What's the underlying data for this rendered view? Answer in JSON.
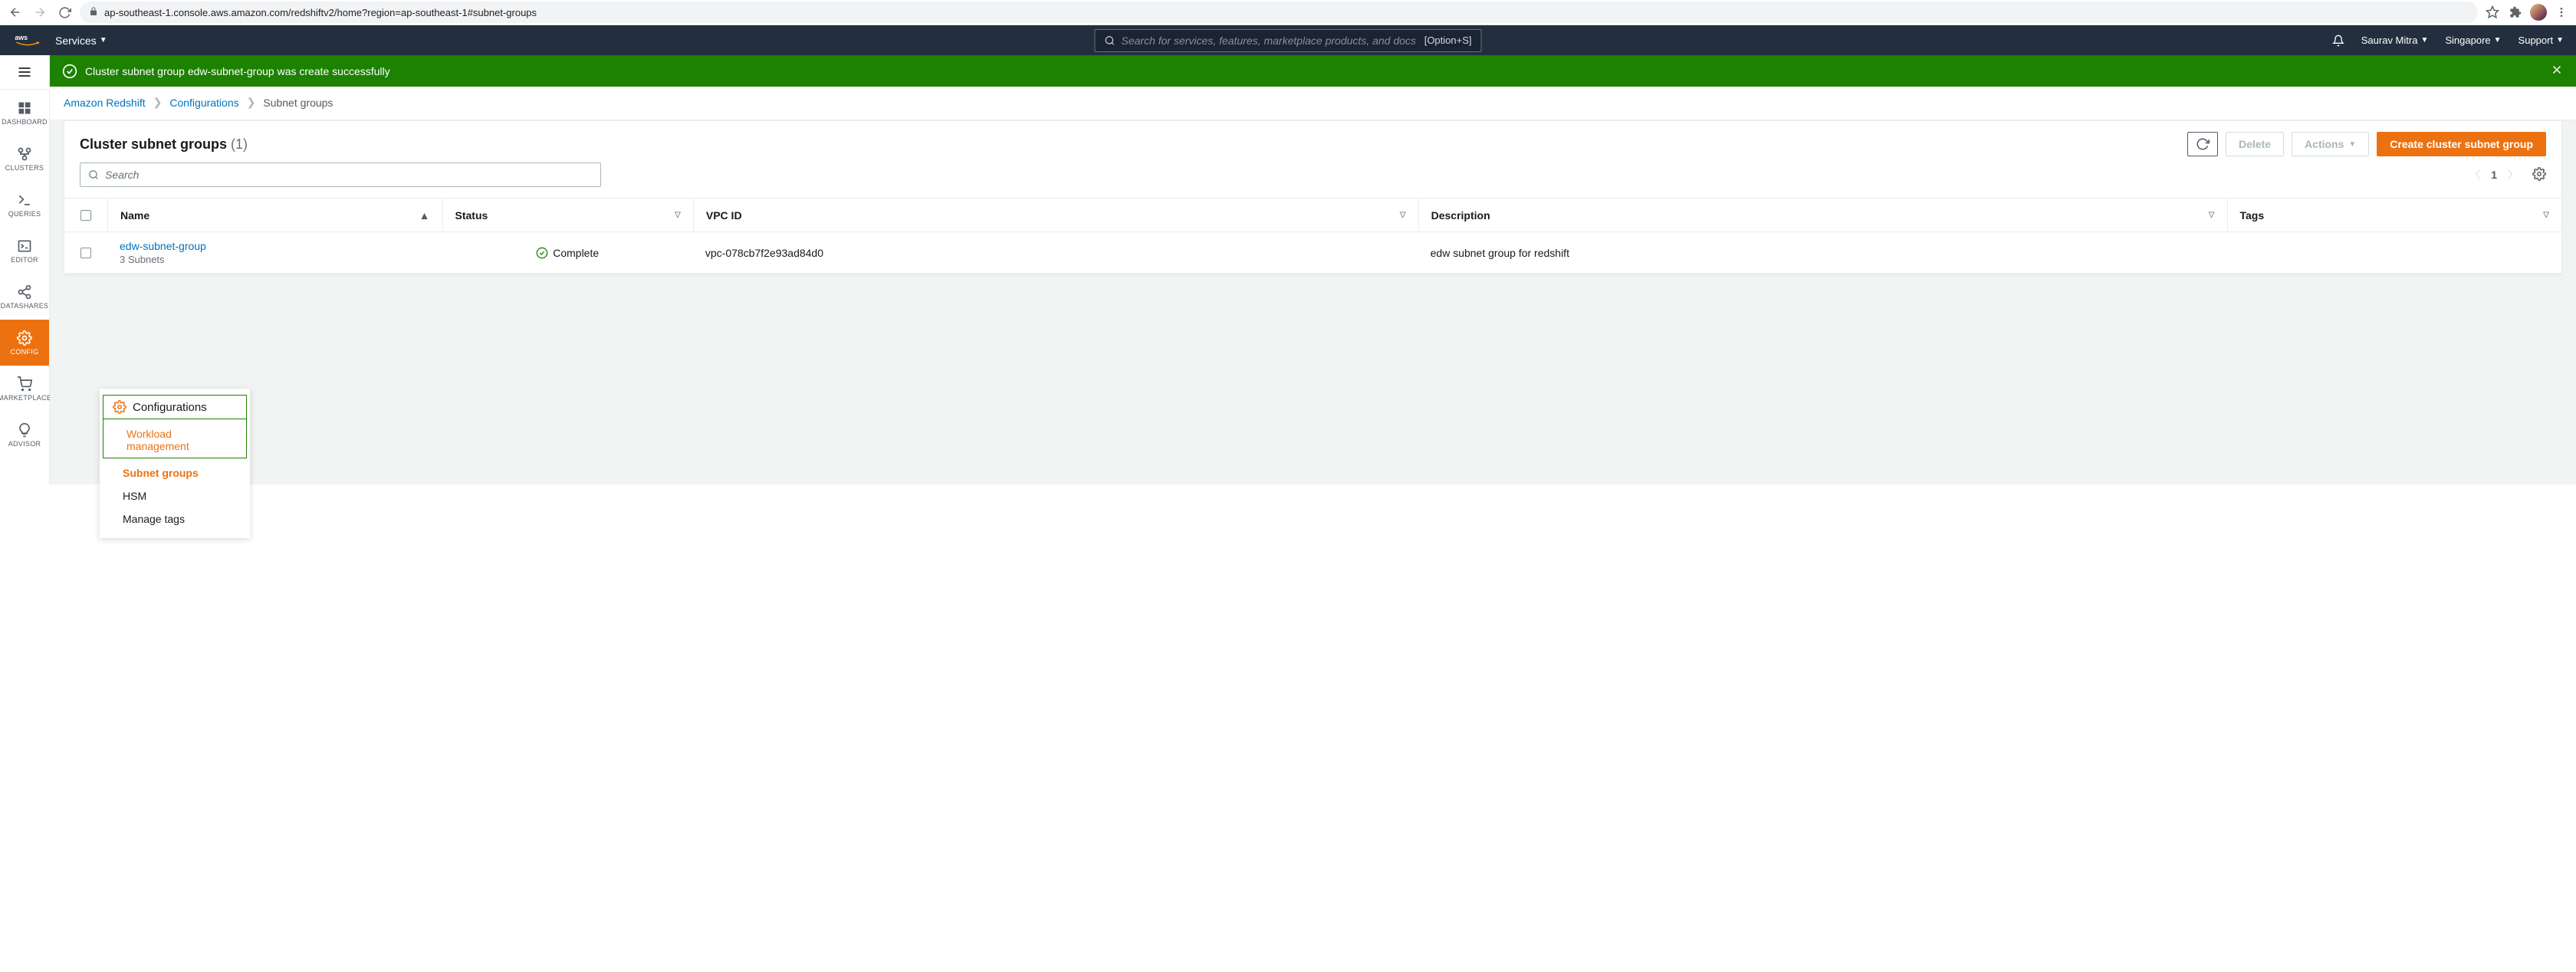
{
  "browser": {
    "url": "ap-southeast-1.console.aws.amazon.com/redshiftv2/home?region=ap-southeast-1#subnet-groups"
  },
  "aws_header": {
    "services": "Services",
    "search_placeholder": "Search for services, features, marketplace products, and docs",
    "kbd": "[Option+S]",
    "user": "Saurav Mitra",
    "region": "Singapore",
    "support": "Support"
  },
  "banner": {
    "message": "Cluster subnet group edw-subnet-group was create successfully"
  },
  "left_nav": {
    "items": [
      {
        "label": "DASHBOARD"
      },
      {
        "label": "CLUSTERS"
      },
      {
        "label": "QUERIES"
      },
      {
        "label": "EDITOR"
      },
      {
        "label": "DATASHARES"
      },
      {
        "label": "CONFIG"
      },
      {
        "label": "MARKETPLACE"
      },
      {
        "label": "ADVISOR"
      }
    ]
  },
  "flyout": {
    "title": "Configurations",
    "items": [
      {
        "label": "Workload management"
      },
      {
        "label": "Subnet groups"
      },
      {
        "label": "HSM"
      },
      {
        "label": "Manage tags"
      }
    ]
  },
  "breadcrumbs": {
    "a": "Amazon Redshift",
    "b": "Configurations",
    "c": "Subnet groups"
  },
  "panel": {
    "title": "Cluster subnet groups",
    "count": "(1)",
    "refresh": "",
    "delete": "Delete",
    "actions": "Actions",
    "create": "Create cluster subnet group",
    "search_placeholder": "Search",
    "page": "1"
  },
  "table": {
    "headers": {
      "name": "Name",
      "status": "Status",
      "vpc": "VPC ID",
      "description": "Description",
      "tags": "Tags"
    },
    "rows": [
      {
        "name": "edw-subnet-group",
        "subnets": "3 Subnets",
        "status": "Complete",
        "vpc": "vpc-078cb7f2e93ad84d0",
        "description": "edw subnet group for redshift",
        "tags": ""
      }
    ]
  }
}
